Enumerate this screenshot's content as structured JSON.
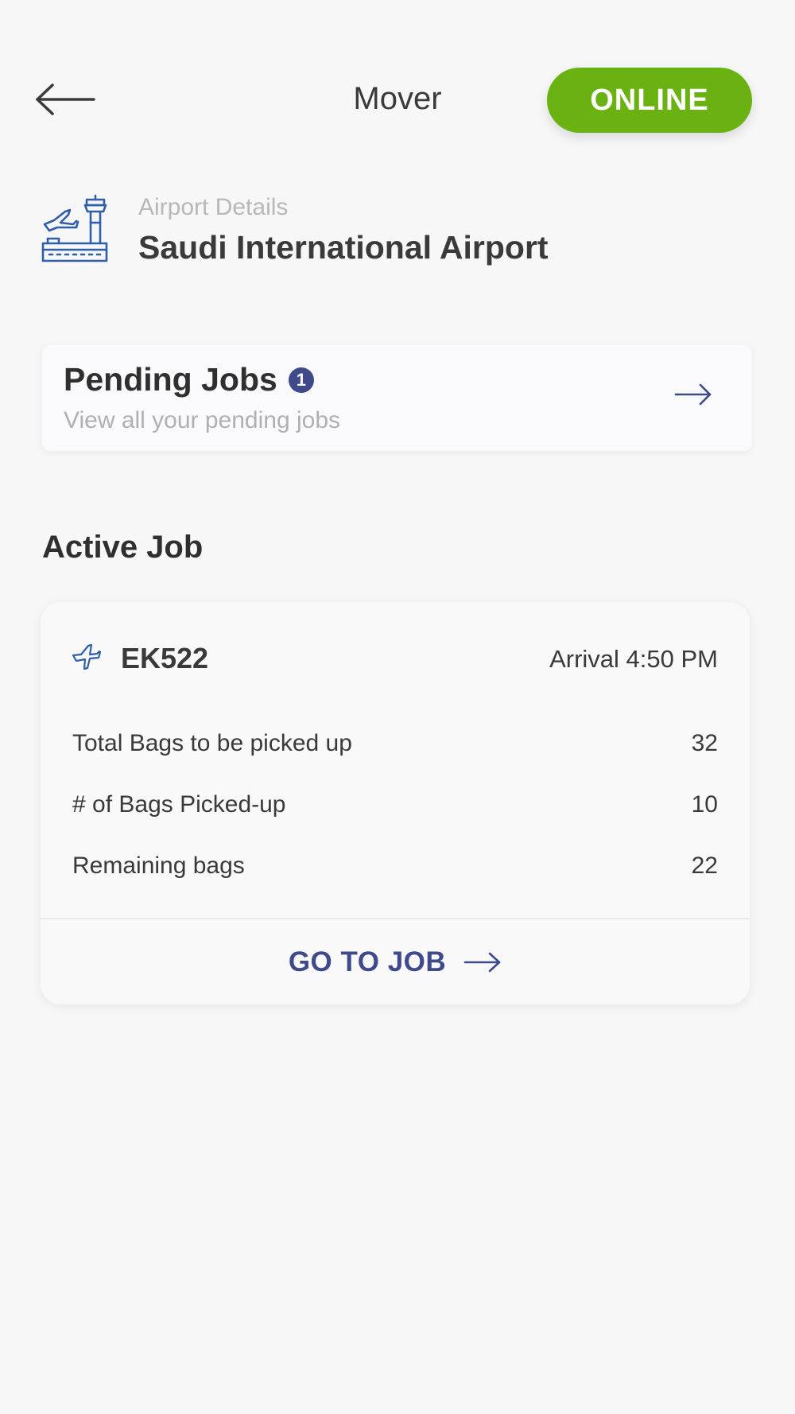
{
  "header": {
    "title": "Mover",
    "status_button": "ONLINE",
    "back_icon": "arrow-left-icon"
  },
  "airport": {
    "label": "Airport Details",
    "name": "Saudi International Airport",
    "icon": "airport-tower-icon"
  },
  "pending_jobs": {
    "title": "Pending Jobs",
    "count": "1",
    "subtitle": "View all your pending jobs",
    "arrow_icon": "arrow-right-icon"
  },
  "active_job": {
    "section_title": "Active Job",
    "flight_icon": "airplane-icon",
    "flight_number": "EK522",
    "arrival": "Arrival 4:50 PM",
    "rows": [
      {
        "label": "Total Bags to be picked up",
        "value": "32"
      },
      {
        "label": "# of Bags Picked-up",
        "value": "10"
      },
      {
        "label": "Remaining bags",
        "value": "22"
      }
    ],
    "go_to_job_label": "GO TO JOB"
  },
  "colors": {
    "background": "#f7f7f8",
    "online_green": "#6ab212",
    "accent_navy": "#3f4a8a",
    "icon_blue": "#2f5fa8",
    "text_dark": "#3a3a3a",
    "text_muted": "#b0b0b0"
  }
}
